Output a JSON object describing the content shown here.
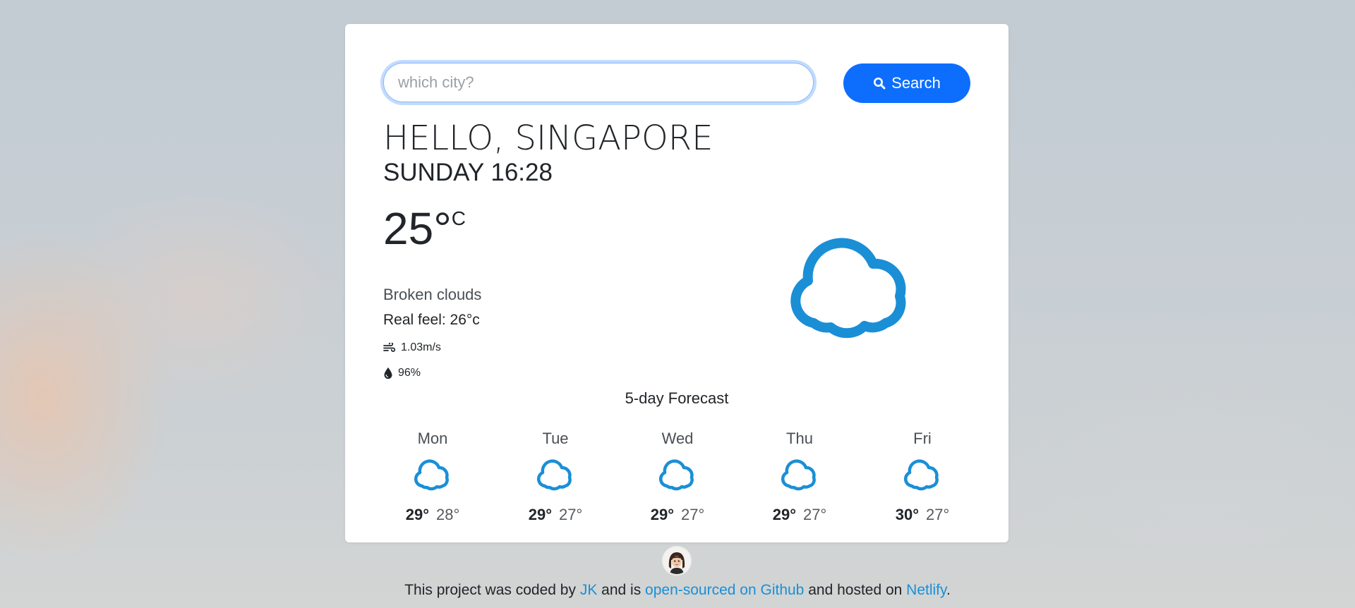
{
  "search": {
    "placeholder": "which city?",
    "value": "",
    "button_label": "Search",
    "button_icon": "search-icon"
  },
  "current": {
    "greeting": "HELLO, SINGAPORE",
    "date_time": "SUNDAY 16:28",
    "temperature": "25°",
    "unit": "C",
    "description": "Broken clouds",
    "real_feel": "Real feel: 26°c",
    "wind": "1.03m/s",
    "wind_icon": "wind-icon",
    "humidity": "96%",
    "humidity_icon": "droplet-icon",
    "icon": "cloud-icon"
  },
  "forecast": {
    "title": "5-day Forecast",
    "days": [
      {
        "day": "Mon",
        "max": "29°",
        "min": "28°",
        "icon": "cloud-icon"
      },
      {
        "day": "Tue",
        "max": "29°",
        "min": "27°",
        "icon": "cloud-icon"
      },
      {
        "day": "Wed",
        "max": "29°",
        "min": "27°",
        "icon": "cloud-icon"
      },
      {
        "day": "Thu",
        "max": "29°",
        "min": "27°",
        "icon": "cloud-icon"
      },
      {
        "day": "Fri",
        "max": "30°",
        "min": "27°",
        "icon": "cloud-icon"
      }
    ]
  },
  "footer": {
    "text_1": "This project was coded by ",
    "author_link": "JK",
    "text_2": " and is ",
    "github_link": "open-sourced on Github",
    "text_3": " and hosted on ",
    "host_link": "Netlify",
    "text_4": "."
  },
  "colors": {
    "accent": "#0d6efd",
    "icon_blue": "#1a8fd6",
    "link": "#1a8fd6"
  }
}
